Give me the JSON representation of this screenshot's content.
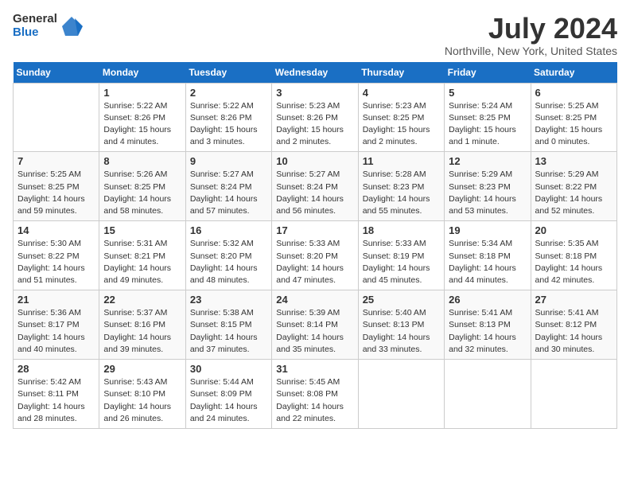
{
  "header": {
    "logo_general": "General",
    "logo_blue": "Blue",
    "title": "July 2024",
    "location": "Northville, New York, United States"
  },
  "weekdays": [
    "Sunday",
    "Monday",
    "Tuesday",
    "Wednesday",
    "Thursday",
    "Friday",
    "Saturday"
  ],
  "weeks": [
    [
      {
        "day": "",
        "lines": []
      },
      {
        "day": "1",
        "lines": [
          "Sunrise: 5:22 AM",
          "Sunset: 8:26 PM",
          "Daylight: 15 hours",
          "and 4 minutes."
        ]
      },
      {
        "day": "2",
        "lines": [
          "Sunrise: 5:22 AM",
          "Sunset: 8:26 PM",
          "Daylight: 15 hours",
          "and 3 minutes."
        ]
      },
      {
        "day": "3",
        "lines": [
          "Sunrise: 5:23 AM",
          "Sunset: 8:26 PM",
          "Daylight: 15 hours",
          "and 2 minutes."
        ]
      },
      {
        "day": "4",
        "lines": [
          "Sunrise: 5:23 AM",
          "Sunset: 8:25 PM",
          "Daylight: 15 hours",
          "and 2 minutes."
        ]
      },
      {
        "day": "5",
        "lines": [
          "Sunrise: 5:24 AM",
          "Sunset: 8:25 PM",
          "Daylight: 15 hours",
          "and 1 minute."
        ]
      },
      {
        "day": "6",
        "lines": [
          "Sunrise: 5:25 AM",
          "Sunset: 8:25 PM",
          "Daylight: 15 hours",
          "and 0 minutes."
        ]
      }
    ],
    [
      {
        "day": "7",
        "lines": [
          "Sunrise: 5:25 AM",
          "Sunset: 8:25 PM",
          "Daylight: 14 hours",
          "and 59 minutes."
        ]
      },
      {
        "day": "8",
        "lines": [
          "Sunrise: 5:26 AM",
          "Sunset: 8:25 PM",
          "Daylight: 14 hours",
          "and 58 minutes."
        ]
      },
      {
        "day": "9",
        "lines": [
          "Sunrise: 5:27 AM",
          "Sunset: 8:24 PM",
          "Daylight: 14 hours",
          "and 57 minutes."
        ]
      },
      {
        "day": "10",
        "lines": [
          "Sunrise: 5:27 AM",
          "Sunset: 8:24 PM",
          "Daylight: 14 hours",
          "and 56 minutes."
        ]
      },
      {
        "day": "11",
        "lines": [
          "Sunrise: 5:28 AM",
          "Sunset: 8:23 PM",
          "Daylight: 14 hours",
          "and 55 minutes."
        ]
      },
      {
        "day": "12",
        "lines": [
          "Sunrise: 5:29 AM",
          "Sunset: 8:23 PM",
          "Daylight: 14 hours",
          "and 53 minutes."
        ]
      },
      {
        "day": "13",
        "lines": [
          "Sunrise: 5:29 AM",
          "Sunset: 8:22 PM",
          "Daylight: 14 hours",
          "and 52 minutes."
        ]
      }
    ],
    [
      {
        "day": "14",
        "lines": [
          "Sunrise: 5:30 AM",
          "Sunset: 8:22 PM",
          "Daylight: 14 hours",
          "and 51 minutes."
        ]
      },
      {
        "day": "15",
        "lines": [
          "Sunrise: 5:31 AM",
          "Sunset: 8:21 PM",
          "Daylight: 14 hours",
          "and 49 minutes."
        ]
      },
      {
        "day": "16",
        "lines": [
          "Sunrise: 5:32 AM",
          "Sunset: 8:20 PM",
          "Daylight: 14 hours",
          "and 48 minutes."
        ]
      },
      {
        "day": "17",
        "lines": [
          "Sunrise: 5:33 AM",
          "Sunset: 8:20 PM",
          "Daylight: 14 hours",
          "and 47 minutes."
        ]
      },
      {
        "day": "18",
        "lines": [
          "Sunrise: 5:33 AM",
          "Sunset: 8:19 PM",
          "Daylight: 14 hours",
          "and 45 minutes."
        ]
      },
      {
        "day": "19",
        "lines": [
          "Sunrise: 5:34 AM",
          "Sunset: 8:18 PM",
          "Daylight: 14 hours",
          "and 44 minutes."
        ]
      },
      {
        "day": "20",
        "lines": [
          "Sunrise: 5:35 AM",
          "Sunset: 8:18 PM",
          "Daylight: 14 hours",
          "and 42 minutes."
        ]
      }
    ],
    [
      {
        "day": "21",
        "lines": [
          "Sunrise: 5:36 AM",
          "Sunset: 8:17 PM",
          "Daylight: 14 hours",
          "and 40 minutes."
        ]
      },
      {
        "day": "22",
        "lines": [
          "Sunrise: 5:37 AM",
          "Sunset: 8:16 PM",
          "Daylight: 14 hours",
          "and 39 minutes."
        ]
      },
      {
        "day": "23",
        "lines": [
          "Sunrise: 5:38 AM",
          "Sunset: 8:15 PM",
          "Daylight: 14 hours",
          "and 37 minutes."
        ]
      },
      {
        "day": "24",
        "lines": [
          "Sunrise: 5:39 AM",
          "Sunset: 8:14 PM",
          "Daylight: 14 hours",
          "and 35 minutes."
        ]
      },
      {
        "day": "25",
        "lines": [
          "Sunrise: 5:40 AM",
          "Sunset: 8:13 PM",
          "Daylight: 14 hours",
          "and 33 minutes."
        ]
      },
      {
        "day": "26",
        "lines": [
          "Sunrise: 5:41 AM",
          "Sunset: 8:13 PM",
          "Daylight: 14 hours",
          "and 32 minutes."
        ]
      },
      {
        "day": "27",
        "lines": [
          "Sunrise: 5:41 AM",
          "Sunset: 8:12 PM",
          "Daylight: 14 hours",
          "and 30 minutes."
        ]
      }
    ],
    [
      {
        "day": "28",
        "lines": [
          "Sunrise: 5:42 AM",
          "Sunset: 8:11 PM",
          "Daylight: 14 hours",
          "and 28 minutes."
        ]
      },
      {
        "day": "29",
        "lines": [
          "Sunrise: 5:43 AM",
          "Sunset: 8:10 PM",
          "Daylight: 14 hours",
          "and 26 minutes."
        ]
      },
      {
        "day": "30",
        "lines": [
          "Sunrise: 5:44 AM",
          "Sunset: 8:09 PM",
          "Daylight: 14 hours",
          "and 24 minutes."
        ]
      },
      {
        "day": "31",
        "lines": [
          "Sunrise: 5:45 AM",
          "Sunset: 8:08 PM",
          "Daylight: 14 hours",
          "and 22 minutes."
        ]
      },
      {
        "day": "",
        "lines": []
      },
      {
        "day": "",
        "lines": []
      },
      {
        "day": "",
        "lines": []
      }
    ]
  ]
}
